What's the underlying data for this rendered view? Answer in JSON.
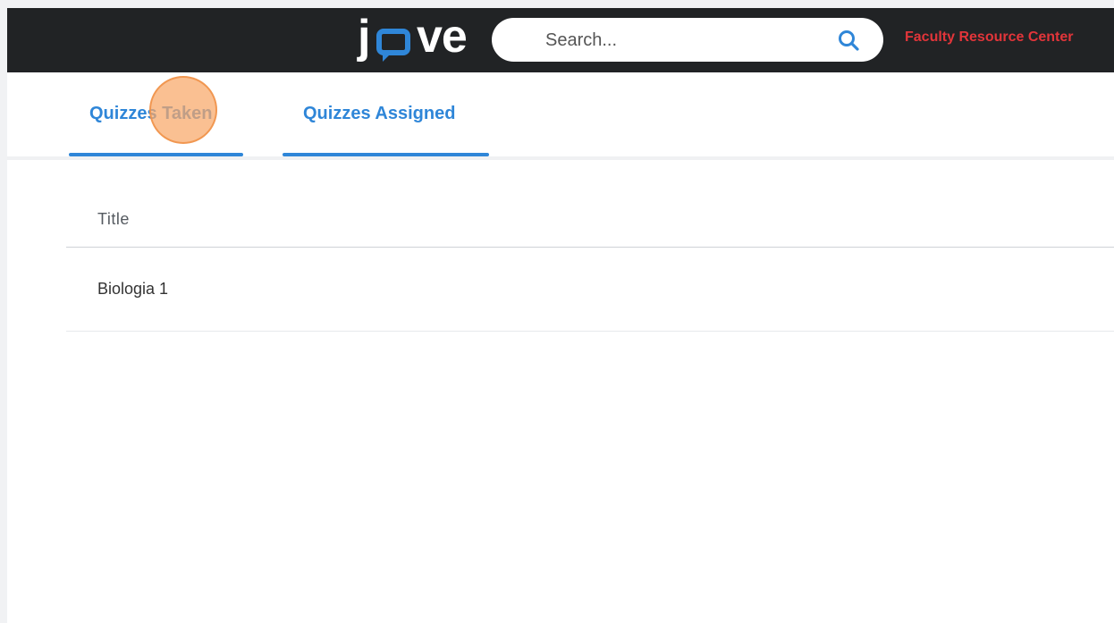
{
  "header": {
    "logo_text_left": "j",
    "logo_text_right": "ve",
    "logo_name": "jove-logo",
    "search": {
      "placeholder": "Search...",
      "value": ""
    },
    "faculty_link": "Faculty Resource Center",
    "colors": {
      "bar": "#212325",
      "logo_accent": "#2f86d8",
      "link": "#e2353a"
    }
  },
  "tabs": [
    {
      "label": "Quizzes Taken"
    },
    {
      "label": "Quizzes Assigned"
    }
  ],
  "table": {
    "columns": [
      "Title"
    ],
    "rows": [
      [
        "Biologia 1"
      ]
    ]
  }
}
